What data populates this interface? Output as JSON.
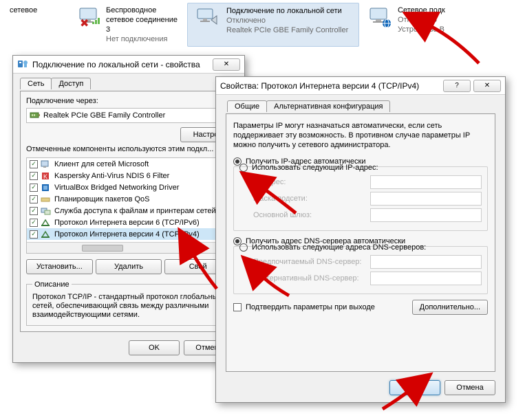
{
  "network_bar": {
    "item0_word": "сетевое",
    "wireless": {
      "title": "Беспроводное сетевое соединение 3",
      "sub": "Нет подключения"
    },
    "lan": {
      "title": "Подключение по локальной сети",
      "sub1": "Отключено",
      "sub2": "Realtek PCIe GBE Family Controller"
    },
    "net": {
      "title": "Сетевое подк",
      "sub1": "Отключено",
      "sub2": "Устройство B"
    }
  },
  "dlg1": {
    "title": "Подключение по локальной сети - свойства",
    "tab_net": "Сеть",
    "tab_share": "Доступ",
    "connect_via": "Подключение через:",
    "adapter": "Realtek PCIe GBE Family Controller",
    "btn_config": "Настро",
    "components_label": "Отмеченные компоненты используются этим подкл...",
    "components": [
      "Клиент для сетей Microsoft",
      "Kaspersky Anti-Virus NDIS 6 Filter",
      "VirtualBox Bridged Networking Driver",
      "Планировщик пакетов QoS",
      "Служба доступа к файлам и принтерам сетей",
      "Протокол Интернета версии 6 (TCP/IPv6)",
      "Протокол Интернета версии 4 (TCP/IPv4)"
    ],
    "btn_install": "Установить...",
    "btn_remove": "Удалить",
    "btn_props": "Свой",
    "desc_title": "Описание",
    "desc_text": "Протокол TCP/IP - стандартный протокол глобальных сетей, обеспечивающий связь между различными взаимодействующими сетями.",
    "btn_ok": "OK",
    "btn_cancel": "Отмена"
  },
  "dlg2": {
    "title": "Свойства: Протокол Интернета версии 4 (TCP/IPv4)",
    "tab_general": "Общие",
    "tab_alt": "Альтернативная конфигурация",
    "intro": "Параметры IP могут назначаться автоматически, если сеть поддерживает эту возможность. В противном случае параметры IP можно получить у сетевого администратора.",
    "radio_ip_auto": "Получить IP-адрес автоматически",
    "radio_ip_manual": "Использовать следующий IP-адрес:",
    "lbl_ip": "IP-адрес:",
    "lbl_mask": "Маска подсети:",
    "lbl_gw": "Основной шлюз:",
    "radio_dns_auto": "Получить адрес DNS-сервера автоматически",
    "radio_dns_manual": "Использовать следующие адреса DNS-серверов:",
    "lbl_dns1": "Предпочитаемый DNS-сервер:",
    "lbl_dns2": "Альтернативный DNS-сервер:",
    "chk_validate": "Подтвердить параметры при выходе",
    "btn_adv": "Дополнительно...",
    "btn_ok": "OK",
    "btn_cancel": "Отмена"
  }
}
